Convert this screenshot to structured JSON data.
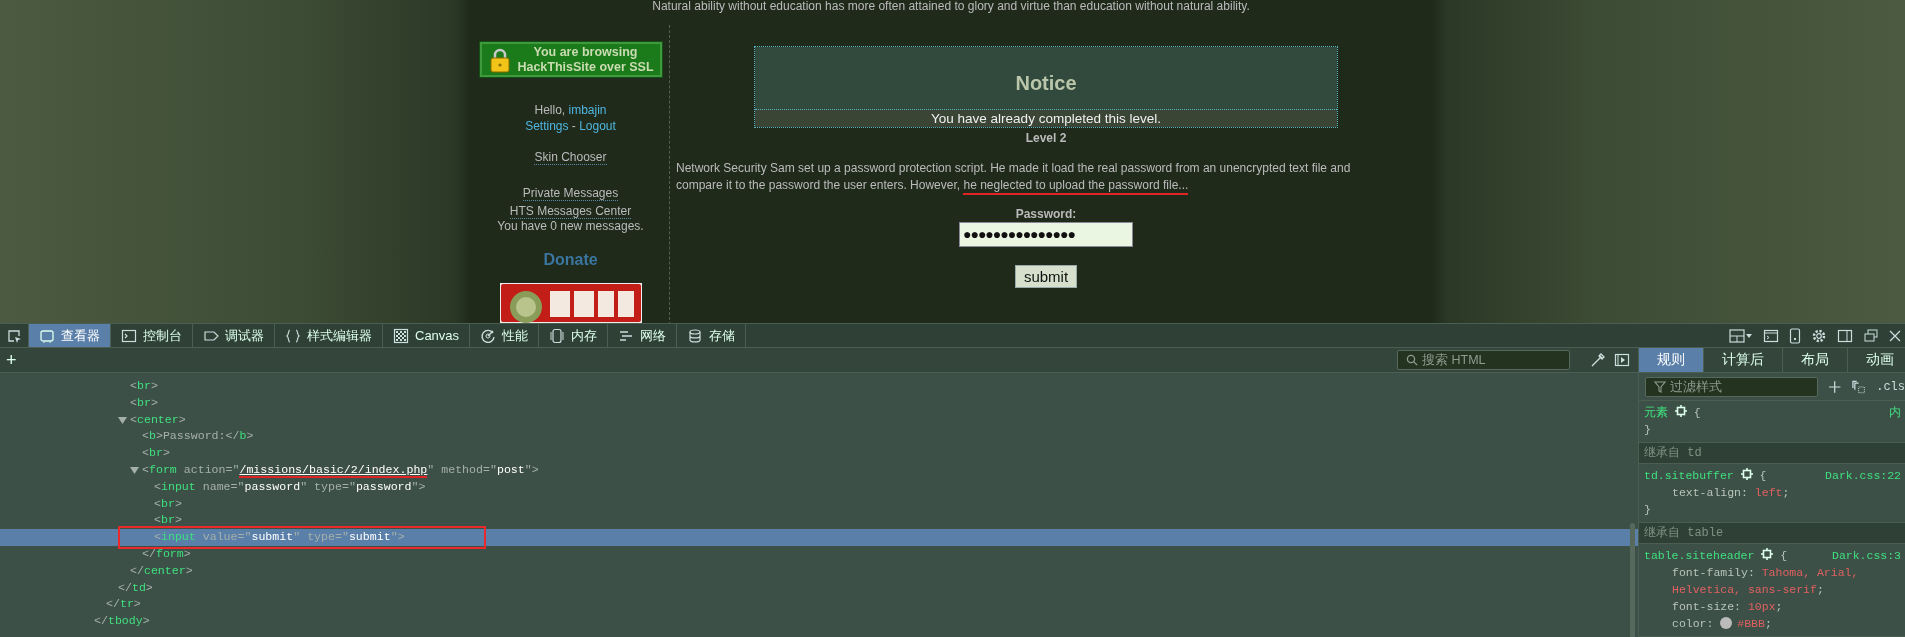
{
  "site": {
    "quote": "Natural ability without education has more often attained to glory and virtue than education without natural ability.",
    "ssl_badge": [
      "You are browsing",
      "HackThisSite over SSL"
    ],
    "greeting": "Hello,",
    "username": "imbajin",
    "account_links": [
      "Settings",
      "Logout"
    ],
    "separator": "-",
    "link_groups": [
      [
        "Skin Chooser"
      ],
      [
        "Private Messages",
        "HTS Messages Center"
      ]
    ],
    "messages_note": "You have 0 new messages.",
    "donate_heading": "Donate",
    "donate_banner": {
      "kind": "picture"
    },
    "notice": {
      "title": "Notice",
      "message": "You have already completed this level."
    },
    "level": "Level 2",
    "description": [
      {
        "text": "Network Security Sam set up a password protection script. He made it load the real password from an unencrypted text file and compare it to the password the user enters. However, ",
        "marked": false
      },
      {
        "text": "he neglected to upload the password file...",
        "marked": true
      }
    ],
    "password": {
      "label": "Password:",
      "value": "●●●●●●●●●●●●●●●"
    },
    "submit": "submit"
  },
  "devtools": {
    "tabs": [
      {
        "label": "查看器",
        "selected": true
      },
      {
        "label": "控制台",
        "selected": false
      },
      {
        "label": "调试器",
        "selected": false
      },
      {
        "label": "样式编辑器",
        "selected": false
      },
      {
        "label": "Canvas",
        "selected": false
      },
      {
        "label": "性能",
        "selected": false
      },
      {
        "label": "内存",
        "selected": false
      },
      {
        "label": "网络",
        "selected": false
      },
      {
        "label": "存储",
        "selected": false
      }
    ],
    "add": "+",
    "search": {
      "placeholder": "搜索 HTML"
    },
    "tree": [
      {
        "close": "</tbody>",
        "children": [
          {
            "close": "</tr>",
            "children": [
              {
                "close": "</td>",
                "children": [
                  {
                    "open": "<br>",
                    "selected": false
                  },
                  {
                    "open": "<br>",
                    "selected": false
                  },
                  {
                    "open": "<center>",
                    "close": "</center>",
                    "expanded": true,
                    "selected": false,
                    "children": [
                      {
                        "open": "<b>Password:</b>",
                        "selected": false
                      },
                      {
                        "open": "<br>",
                        "selected": false
                      },
                      {
                        "open": "<form action=\"/missions/basic/2/index.php\" method=\"post\">",
                        "close": "</form>",
                        "expanded": true,
                        "selected": false,
                        "link": true,
                        "marked": true,
                        "children": [
                          {
                            "open": "<input name=\"password\" type=\"password\">",
                            "selected": false
                          },
                          {
                            "open": "<br>",
                            "selected": false
                          },
                          {
                            "open": "<br>",
                            "selected": false
                          },
                          {
                            "open": "<input value=\"submit\" type=\"submit\">",
                            "selected": true,
                            "marked": true
                          }
                        ]
                      }
                    ]
                  }
                ]
              }
            ]
          }
        ]
      }
    ],
    "side_tabs": [
      {
        "label": "规则",
        "selected": true
      },
      {
        "label": "计算后",
        "selected": false
      },
      {
        "label": "布局",
        "selected": false
      },
      {
        "label": "动画",
        "selected": false
      }
    ],
    "filter": {
      "placeholder": "过滤样式"
    },
    "cls": ".cls",
    "rules": [
      {
        "kind": "rule",
        "selector": "元素",
        "open": "{",
        "close": "}",
        "source": "内"
      },
      {
        "kind": "inherited",
        "label": "继承自",
        "from": "td"
      },
      {
        "kind": "rule",
        "selector": "td.sitebuffer",
        "open": "{",
        "close": "}",
        "source": "Dark.css:22",
        "declarations": [
          "text-align: left;"
        ]
      },
      {
        "kind": "inherited",
        "label": "继承自",
        "from": "table"
      },
      {
        "kind": "rule",
        "selector": "table.siteheader",
        "open": "{",
        "source": "Dark.css:3",
        "declarations": [
          "font-family: Tahoma, Arial, Helvetica, sans-serif;",
          "font-size: 10px;",
          "color: #BBB;"
        ]
      }
    ]
  }
}
